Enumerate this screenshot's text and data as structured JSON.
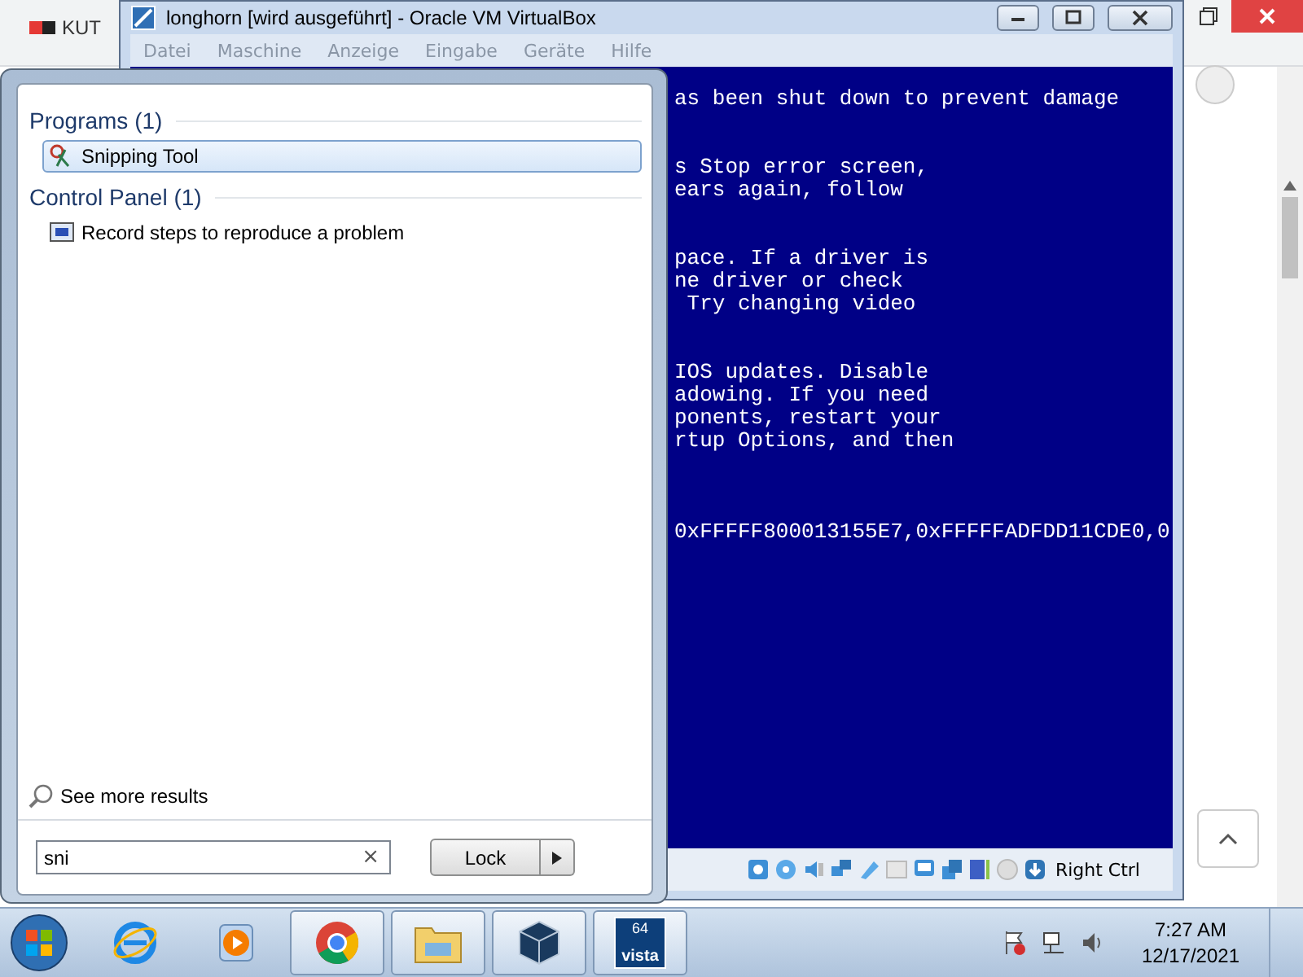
{
  "browser": {
    "tab_title": "KUT"
  },
  "vm_window": {
    "title": "longhorn [wird ausgeführt] - Oracle VM VirtualBox",
    "menu": [
      "Datei",
      "Maschine",
      "Anzeige",
      "Eingabe",
      "Geräte",
      "Hilfe"
    ],
    "screen": {
      "paragraphs": [
        {
          "kind": "text",
          "lines": [
            "as been shut down to prevent damage"
          ]
        },
        {
          "kind": "text",
          "lines": [
            "s Stop error screen,",
            "ears again, follow"
          ]
        },
        {
          "kind": "text",
          "lines": [
            "pace. If a driver is",
            "ne driver or check",
            " Try changing video"
          ]
        },
        {
          "kind": "text",
          "lines": [
            "IOS updates. Disable",
            "adowing. If you need",
            "ponents, restart your",
            "rtup Options, and then"
          ]
        },
        {
          "kind": "parameters",
          "lines": [
            "0xFFFFF800013155E7,0xFFFFFADFDD11CDE0,0"
          ]
        }
      ]
    },
    "status": {
      "host_key": "Right Ctrl"
    }
  },
  "start_menu": {
    "groups": [
      {
        "heading": "Programs (1)",
        "items": [
          {
            "kind": "scissors",
            "label": "Snipping Tool",
            "selected": true
          }
        ]
      },
      {
        "heading": "Control Panel (1)",
        "items": [
          {
            "kind": "recorder",
            "label": "Record steps to reproduce a problem",
            "selected": false
          }
        ]
      }
    ],
    "see_more": "See more results",
    "search": {
      "value": "sni",
      "clear": "×"
    },
    "power_button": "Lock"
  },
  "taskbar": {
    "apps": [
      {
        "kind": "ie",
        "running": false
      },
      {
        "kind": "media",
        "running": false
      },
      {
        "kind": "chrome",
        "running": true
      },
      {
        "kind": "explorer",
        "running": true
      },
      {
        "kind": "virtualbox",
        "running": true
      },
      {
        "kind": "vista",
        "running": true,
        "badge": "64",
        "caption": "vista"
      }
    ],
    "clock": {
      "time": "7:27 AM",
      "date": "12/17/2021"
    }
  }
}
